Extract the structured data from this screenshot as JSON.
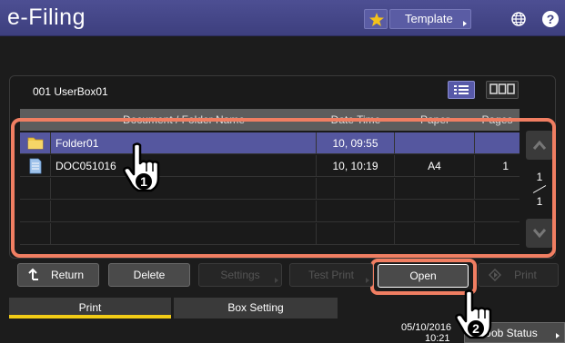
{
  "header": {
    "title": "e-Filing",
    "template_label": "Template",
    "star_icon": "star-icon",
    "globe_icon": "globe-icon",
    "help_label": "?"
  },
  "box": {
    "name": "001 UserBox01"
  },
  "table": {
    "columns": [
      "Document / Folder Name",
      "Date Time",
      "Paper",
      "Pages"
    ],
    "rows": [
      {
        "icon": "folder-icon",
        "name": "Folder01",
        "date_time": "10, 09:55",
        "paper": "",
        "pages": "",
        "selected": true
      },
      {
        "icon": "document-icon",
        "name": "DOC051016",
        "date_time": "10, 10:19",
        "paper": "A4",
        "pages": "1",
        "selected": false
      }
    ]
  },
  "pagination": {
    "current": "1",
    "total": "1"
  },
  "buttons": {
    "return": "Return",
    "delete": "Delete",
    "settings": "Settings",
    "test_print": "Test Print",
    "open": "Open",
    "print": "Print"
  },
  "tabs": {
    "print": "Print",
    "box_setting": "Box Setting"
  },
  "status": {
    "date": "05/10/2016",
    "time": "10:21",
    "job_status": "Job Status"
  },
  "callouts": {
    "step1": "1",
    "step2": "2"
  },
  "colors": {
    "accent": "#55579f",
    "highlight": "#f07e62",
    "tab_active": "#f2cc16"
  }
}
